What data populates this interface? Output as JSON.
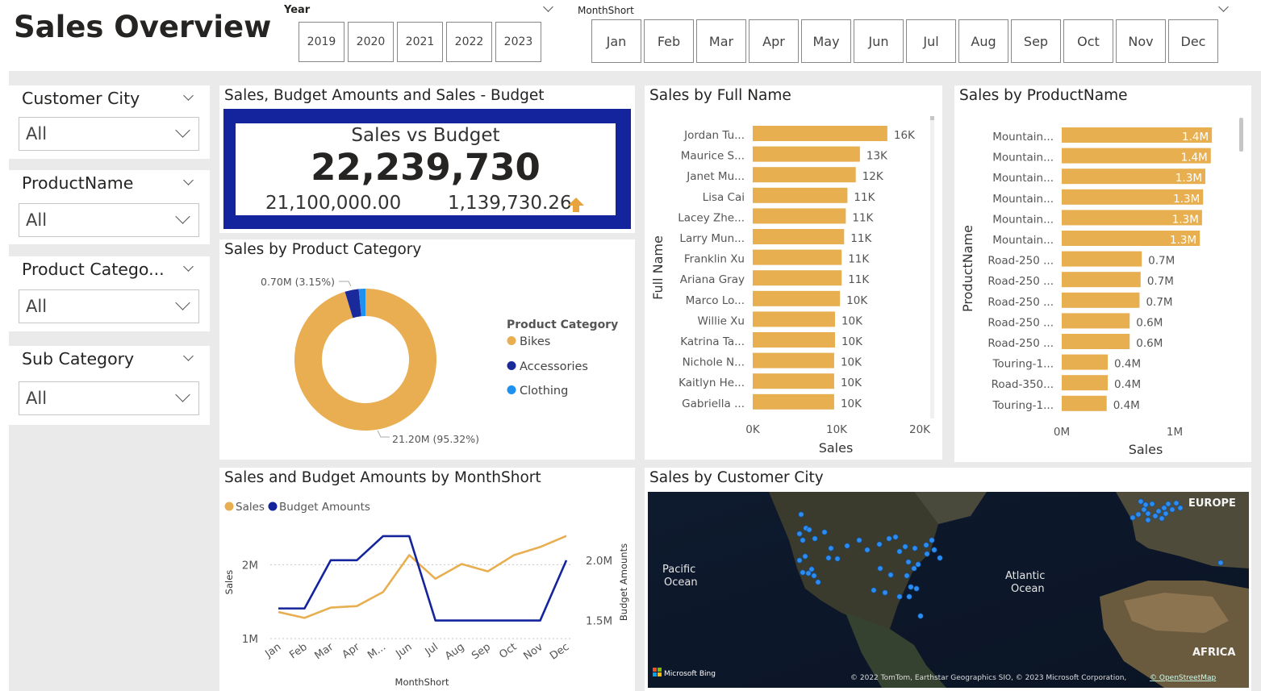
{
  "page_title": "Sales Overview",
  "year_slicer": {
    "title": "Year",
    "options": [
      "2019",
      "2020",
      "2021",
      "2022",
      "2023"
    ]
  },
  "month_slicer": {
    "title": "MonthShort",
    "options": [
      "Jan",
      "Feb",
      "Mar",
      "Apr",
      "May",
      "Jun",
      "Jul",
      "Aug",
      "Sep",
      "Oct",
      "Nov",
      "Dec"
    ]
  },
  "side_slicers": [
    {
      "label": "Customer City",
      "value": "All"
    },
    {
      "label": "ProductName",
      "value": "All"
    },
    {
      "label": "Product Catego...",
      "value": "All"
    },
    {
      "label": "Sub Category",
      "value": "All"
    }
  ],
  "kpi": {
    "panel_title": "Sales, Budget Amounts and Sales - Budget",
    "title": "Sales vs Budget",
    "value": "22,239,730",
    "budget": "21,100,000.00",
    "difference": "1,139,730.26",
    "accent": "#e8a33d",
    "frame_color": "#13249c"
  },
  "colors": {
    "bar": "#e8af51",
    "bike": "#e8ae51",
    "accessories": "#1a2a9a",
    "clothing": "#1e90f0",
    "budget_line": "#13249c"
  },
  "donut": {
    "panel_title": "Sales by Product Category",
    "legend_title": "Product Category",
    "label_small": "0.70M (3.15%)",
    "label_large": "21.20M (95.32%)",
    "chart_data": {
      "type": "pie",
      "categories": [
        "Bikes",
        "Accessories",
        "Clothing"
      ],
      "values": [
        21.2,
        0.7,
        0.34
      ],
      "percent": [
        95.32,
        3.15,
        1.53
      ]
    }
  },
  "fullname_chart": {
    "panel_title": "Sales by Full Name",
    "xlabel": "Sales",
    "ylabel": "Full Name",
    "ticks": [
      "0K",
      "10K",
      "20K"
    ],
    "chart_data": {
      "type": "bar",
      "orientation": "horizontal",
      "categories": [
        "Jordan Tu...",
        "Maurice S...",
        "Janet Mu...",
        "Lisa Cai",
        "Lacey Zhe...",
        "Larry Mun...",
        "Franklin Xu",
        "Ariana Gray",
        "Marco Lo...",
        "Willie Xu",
        "Katrina Ta...",
        "Nichole N...",
        "Kaitlyn He...",
        "Gabriella ..."
      ],
      "values": [
        16200,
        12900,
        12400,
        11400,
        11200,
        11000,
        10700,
        10700,
        10500,
        9900,
        9900,
        9800,
        9800,
        9800
      ],
      "labels": [
        "16K",
        "13K",
        "12K",
        "11K",
        "11K",
        "11K",
        "11K",
        "11K",
        "10K",
        "10K",
        "10K",
        "10K",
        "10K",
        "10K"
      ],
      "xlim": [
        0,
        20000
      ]
    }
  },
  "product_chart": {
    "panel_title": "Sales by ProductName",
    "xlabel": "Sales",
    "ylabel": "ProductName",
    "ticks": [
      "0M",
      "1M"
    ],
    "chart_data": {
      "type": "bar",
      "orientation": "horizontal",
      "categories": [
        "Mountain...",
        "Mountain...",
        "Mountain...",
        "Mountain...",
        "Mountain...",
        "Mountain...",
        "Road-250 ...",
        "Road-250 ...",
        "Road-250 ...",
        "Road-250 ...",
        "Road-250 ...",
        "Touring-1...",
        "Road-350...",
        "Touring-1..."
      ],
      "values": [
        1.37,
        1.36,
        1.31,
        1.29,
        1.28,
        1.26,
        0.73,
        0.72,
        0.71,
        0.62,
        0.62,
        0.42,
        0.42,
        0.41
      ],
      "labels": [
        "1.4M",
        "1.4M",
        "1.3M",
        "1.3M",
        "1.3M",
        "1.3M",
        "0.7M",
        "0.7M",
        "0.7M",
        "0.6M",
        "0.6M",
        "0.4M",
        "0.4M",
        "0.4M"
      ],
      "xlim": [
        0,
        1.45
      ]
    }
  },
  "line_chart": {
    "panel_title": "Sales and Budget Amounts by MonthShort",
    "legend": [
      "Sales",
      "Budget Amounts"
    ],
    "xlabel": "MonthShort",
    "ylabel_left": "Sales",
    "ylabel_right": "Budget Amounts",
    "left_ticks": [
      "2M",
      "1M"
    ],
    "right_ticks": [
      "2.0M",
      "1.5M"
    ],
    "chart_data": {
      "type": "line",
      "x": [
        "Jan",
        "Feb",
        "Mar",
        "Apr",
        "M...",
        "Jun",
        "Jul",
        "Aug",
        "Sep",
        "Oct",
        "Nov",
        "Dec"
      ],
      "series": [
        {
          "name": "Sales",
          "axis": "left",
          "values": [
            1.36,
            1.28,
            1.42,
            1.44,
            1.63,
            2.13,
            1.81,
            2.01,
            1.91,
            2.13,
            2.24,
            2.39
          ]
        },
        {
          "name": "Budget Amounts",
          "axis": "right",
          "values": [
            1.6,
            1.6,
            2.0,
            2.0,
            2.2,
            2.2,
            1.5,
            1.5,
            1.5,
            1.5,
            1.5,
            2.0
          ]
        }
      ],
      "ylim_left": [
        1.0,
        2.55
      ],
      "ylim_right": [
        1.35,
        2.3
      ]
    }
  },
  "map": {
    "panel_title": "Sales by Customer City",
    "labels": [
      "Pacific\nOcean",
      "Atlantic\nOcean",
      "EUROPE",
      "AFRICA"
    ],
    "attribution": "© 2022 TomTom, Earthstar Geographics SIO, © 2023 Microsoft Corporation,",
    "attribution_link": "© OpenStreetMap",
    "bing": "Microsoft Bing"
  }
}
